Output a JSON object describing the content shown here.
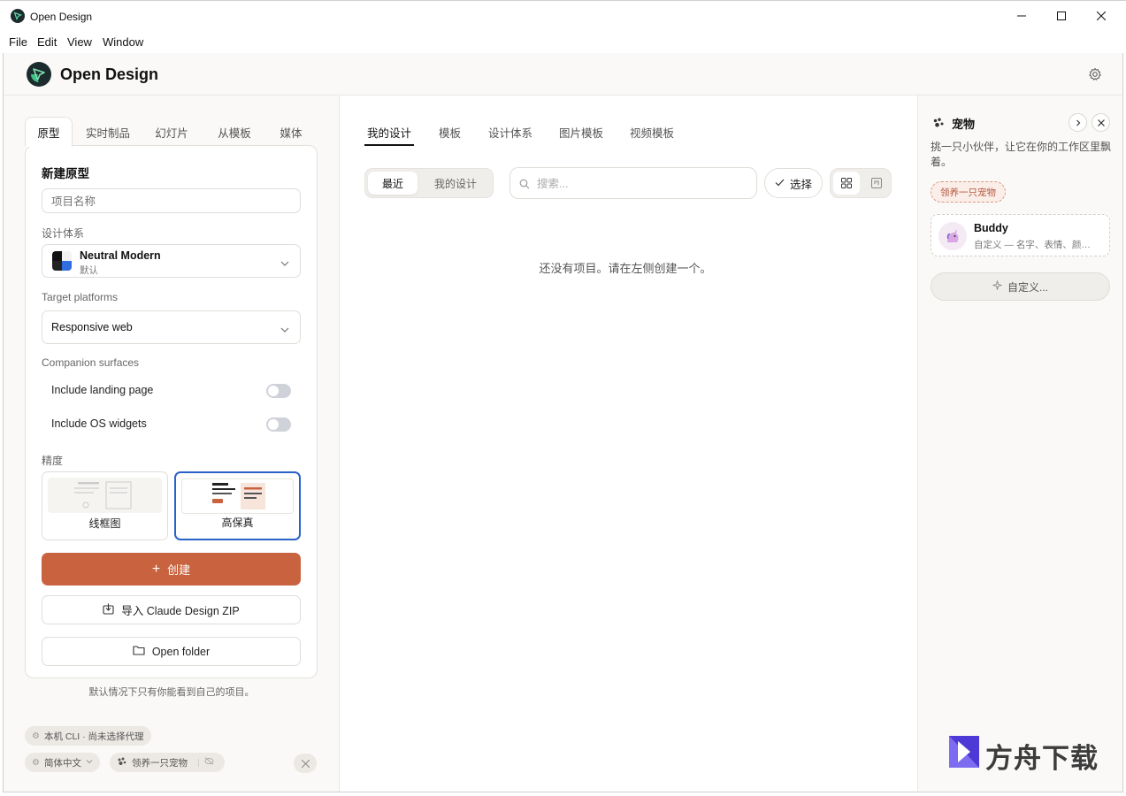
{
  "window": {
    "title": "Open Design",
    "controls": [
      "minimize-icon",
      "maximize-icon",
      "close-icon"
    ]
  },
  "menu": [
    "File",
    "Edit",
    "View",
    "Window"
  ],
  "header": {
    "brand": "Open Design",
    "settings_icon": "gear-icon"
  },
  "left": {
    "tabs": [
      "原型",
      "实时制品",
      "幻灯片",
      "从模板",
      "媒体"
    ],
    "active_tab": "原型",
    "heading": "新建原型",
    "project_name_placeholder": "项目名称",
    "design_system_label": "设计体系",
    "design_system": {
      "name": "Neutral Modern",
      "sub": "默认"
    },
    "platforms_label": "Target platforms",
    "platform_value": "Responsive web",
    "companion_label": "Companion surfaces",
    "toggles": [
      {
        "label": "Include landing page",
        "on": false
      },
      {
        "label": "Include OS widgets",
        "on": false
      }
    ],
    "fidelity_label": "精度",
    "fidelity_options": [
      "线框图",
      "高保真"
    ],
    "fidelity_selected": "高保真",
    "create_button": "创建",
    "import_button": "导入 Claude Design ZIP",
    "open_folder_button": "Open folder",
    "privacy_note": "默认情况下只有你能看到自己的项目。",
    "chips": {
      "agent": "本机 CLI · 尚未选择代理",
      "language": "简体中文",
      "pet": "领养一只宠物"
    }
  },
  "main": {
    "tabs": [
      "我的设计",
      "模板",
      "设计体系",
      "图片模板",
      "视频模板"
    ],
    "active_tab": "我的设计",
    "segments": [
      "最近",
      "我的设计"
    ],
    "active_segment": "最近",
    "search_placeholder": "搜索...",
    "select_button": "选择",
    "empty_text": "还没有项目。请在左侧创建一个。"
  },
  "right": {
    "title": "宠物",
    "description": "挑一只小伙伴，让它在你的工作区里飘着。",
    "adopt_chip": "领养一只宠物",
    "pet": {
      "name": "Buddy",
      "desc": "自定义 — 名字、表情、颜…"
    },
    "customize_button": "自定义..."
  },
  "watermark": "方舟下载",
  "colors": {
    "accent": "#c8623f",
    "selection": "#2a62c9",
    "brand_teal": "#1f7a6b"
  }
}
